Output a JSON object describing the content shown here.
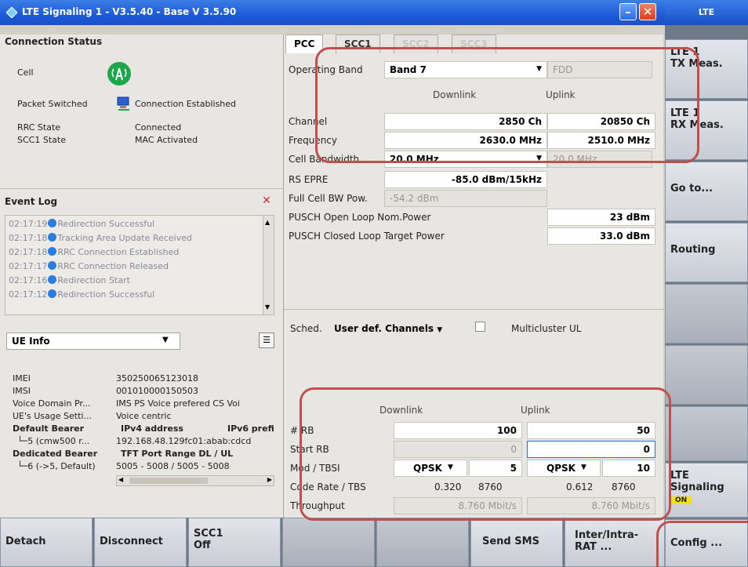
{
  "window": {
    "title": "LTE Signaling 1 - V3.5.40 - Base V 3.5.90"
  },
  "connection_status": {
    "header": "Connection Status",
    "cell_label": "Cell",
    "packet_switched_label": "Packet Switched",
    "packet_switched_value": "Connection Established",
    "rrc_state_label": "RRC State",
    "rrc_state_value": "Connected",
    "scc1_state_label": "SCC1 State",
    "scc1_state_value": "MAC Activated"
  },
  "event_log": {
    "header": "Event Log",
    "entries": [
      {
        "time": "02:17:19",
        "text": "Redirection Successful"
      },
      {
        "time": "02:17:18",
        "text": "Tracking Area Update Received"
      },
      {
        "time": "02:17:18",
        "text": "RRC Connection Established"
      },
      {
        "time": "02:17:17",
        "text": "RRC Connection Released"
      },
      {
        "time": "02:17:16",
        "text": "Redirection Start"
      },
      {
        "time": "02:17:12",
        "text": "Redirection Successful"
      }
    ]
  },
  "ue_info": {
    "selector": "UE Info",
    "imei_label": "IMEI",
    "imei": "350250065123018",
    "imsi_label": "IMSI",
    "imsi": "001010000150503",
    "voice_domain_label": "Voice Domain Pr...",
    "voice_domain": "IMS PS Voice prefered CS Voi",
    "usage_label": "UE's Usage Setti...",
    "usage": "Voice centric",
    "default_bearer_label": "Default Bearer",
    "ipv4_label": "IPv4 address",
    "ipv6_label": "IPv6 prefi",
    "default_bearer_item": "5 (cmw500 r...",
    "default_bearer_ip": "192.168.48.129",
    "default_bearer_ipv6": "fc01:abab:cdcd",
    "dedicated_bearer_label": "Dedicated Bearer",
    "tft_label": "TFT Port Range DL / UL",
    "dedicated_item": "6 (->5, Default)",
    "tft_values": "5005 - 5008 / 5005 - 5008"
  },
  "tabs": [
    "PCC",
    "SCC1",
    "SCC2",
    "SCC3"
  ],
  "pcc": {
    "operating_band_label": "Operating Band",
    "operating_band": "Band 7",
    "duplex": "FDD",
    "downlink_header": "Downlink",
    "uplink_header": "Uplink",
    "channel_label": "Channel",
    "channel_dl": "2850 Ch",
    "channel_ul": "20850 Ch",
    "frequency_label": "Frequency",
    "frequency_dl": "2630.0 MHz",
    "frequency_ul": "2510.0 MHz",
    "cell_bw_label": "Cell Bandwidth",
    "cell_bw_dl": "20.0 MHz",
    "cell_bw_ul": "20.0 MHz",
    "rs_epre_label": "RS EPRE",
    "rs_epre": "-85.0 dBm/15kHz",
    "full_cell_bw_label": "Full Cell BW Pow.",
    "full_cell_bw": "-54.2 dBm",
    "pusch_open_label": "PUSCH Open Loop Nom.Power",
    "pusch_open": "23 dBm",
    "pusch_closed_label": "PUSCH Closed Loop Target Power",
    "pusch_closed": "33.0 dBm"
  },
  "scheduling": {
    "sched_label": "Sched.",
    "sched_value": "User def. Channels",
    "multicluster_label": "Multicluster UL",
    "downlink_header": "Downlink",
    "uplink_header": "Uplink",
    "rb_label": "# RB",
    "rb_dl": "100",
    "rb_ul": "50",
    "start_rb_label": "Start RB",
    "start_rb_dl": "0",
    "start_rb_ul": "0",
    "mod_label": "Mod / TBSI",
    "mod_dl": "QPSK",
    "tbsi_dl": "5",
    "mod_ul": "QPSK",
    "tbsi_ul": "10",
    "code_rate_label": "Code Rate / TBS",
    "code_rate_dl": "0.320",
    "tbs_dl": "8760",
    "code_rate_ul": "0.612",
    "tbs_ul": "8760",
    "throughput_label": "Throughput",
    "throughput_dl": "8.760 Mbit/s",
    "throughput_ul": "8.760 Mbit/s"
  },
  "right_panel": {
    "header": "LTE",
    "btn_tx": "LTE 1\nTX Meas.",
    "btn_tx_l1": "LTE 1",
    "btn_tx_l2": "TX Meas.",
    "btn_rx_l1": "LTE 1",
    "btn_rx_l2": "RX Meas.",
    "btn_goto": "Go to...",
    "btn_routing": "Routing",
    "btn_signaling_l1": "LTE",
    "btn_signaling_l2": "Signaling",
    "signaling_state": "ON",
    "btn_config": "Config ..."
  },
  "bottom_bar": {
    "detach": "Detach",
    "disconnect": "Disconnect",
    "scc1_l1": "SCC1",
    "scc1_l2": "Off",
    "send_sms": "Send SMS",
    "inter_l1": "Inter/Intra-",
    "inter_l2": "RAT ..."
  },
  "colors": {
    "title_bar": "#1c5ad8",
    "highlight_box": "#c0504d",
    "status_on": "#f0e020"
  }
}
